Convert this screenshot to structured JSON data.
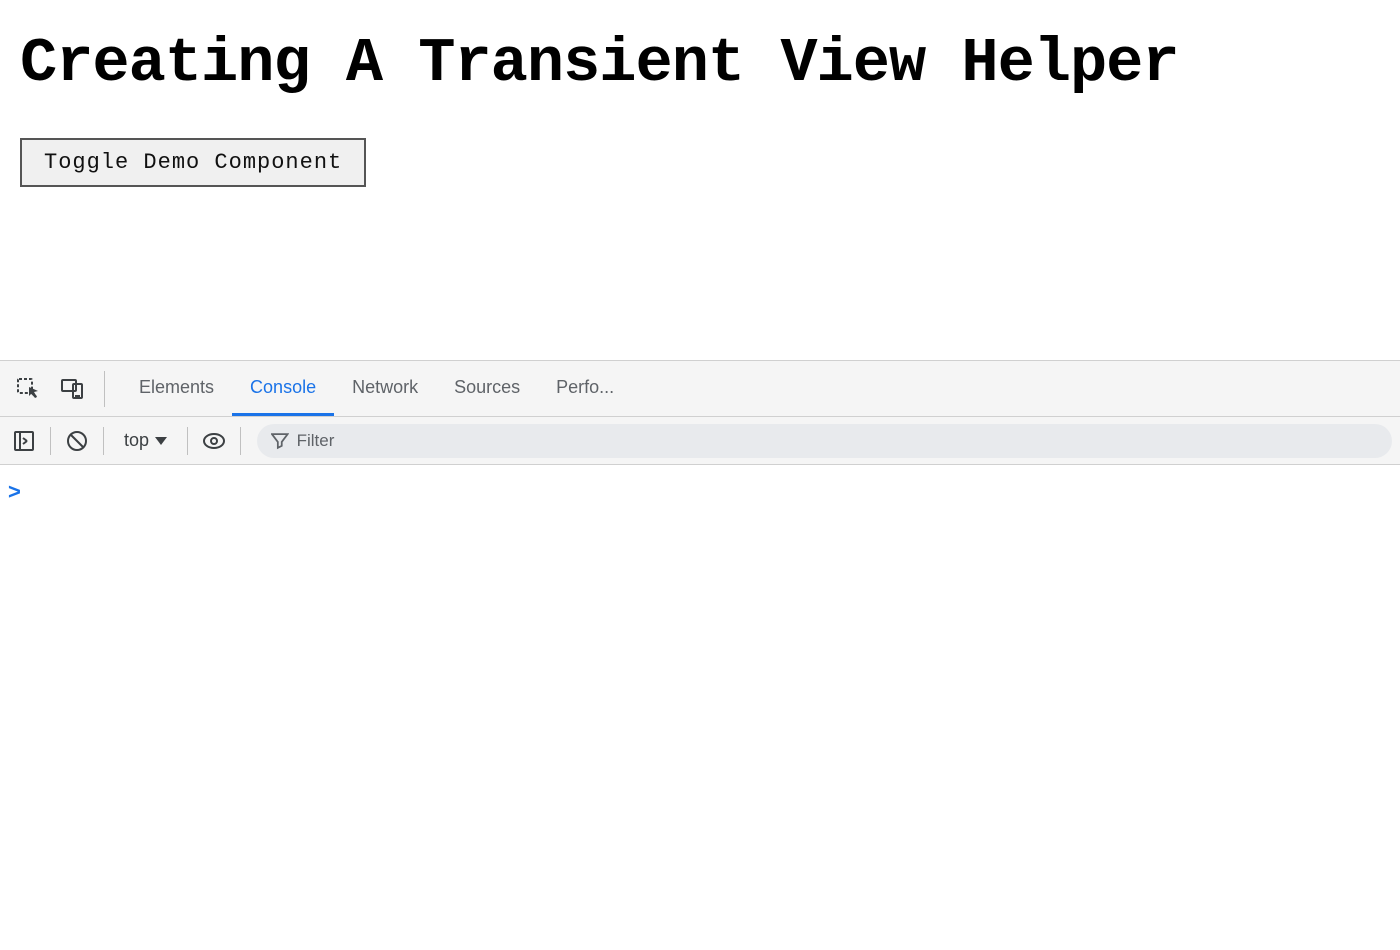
{
  "page": {
    "title": "Creating A Transient View Helper",
    "toggle_button_label": "Toggle Demo Component"
  },
  "devtools": {
    "tabs": [
      {
        "id": "elements",
        "label": "Elements",
        "active": false
      },
      {
        "id": "console",
        "label": "Console",
        "active": true
      },
      {
        "id": "network",
        "label": "Network",
        "active": false
      },
      {
        "id": "sources",
        "label": "Sources",
        "active": false
      },
      {
        "id": "performance",
        "label": "Perfo...",
        "active": false
      }
    ],
    "console_toolbar": {
      "top_selector_label": "top",
      "filter_placeholder": "Filter"
    }
  },
  "icons": {
    "inspect": "inspect-icon",
    "device": "device-icon",
    "expand_sidebar": "expand-sidebar-icon",
    "clear": "clear-icon",
    "eye": "eye-icon",
    "filter": "filter-icon",
    "chevron_right": "chevron-right-icon",
    "dropdown_arrow": "dropdown-arrow-icon"
  },
  "colors": {
    "active_tab": "#1a73e8",
    "text": "#3c4043",
    "muted": "#5f6368",
    "bg": "#f5f5f5",
    "border": "#d0d0d0",
    "chevron_blue": "#1a73e8"
  }
}
